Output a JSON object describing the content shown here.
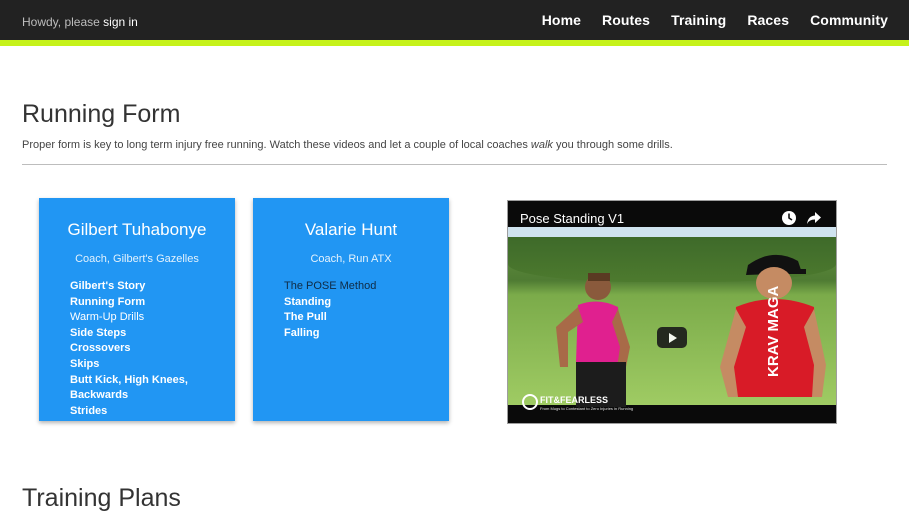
{
  "header": {
    "greeting_prefix": "Howdy, please",
    "signin_label": "sign in",
    "nav": [
      "Home",
      "Routes",
      "Training",
      "Races",
      "Community"
    ],
    "accent_color": "#c6f21a",
    "bar_color": "#222222"
  },
  "main": {
    "title": "Running Form",
    "intro_before": "Proper form is key to long term injury free running. Watch these videos and let a couple of local coaches",
    "intro_em": "walk",
    "intro_after": "you through some drills.",
    "card_color": "#2196f3",
    "coaches": [
      {
        "name": "Gilbert Tuhabonye",
        "role": "Coach, Gilbert's Gazelles",
        "links": [
          "Gilbert's Story",
          "Running Form",
          "Warm-Up Drills",
          "Side Steps",
          "Crossovers",
          "Skips",
          "Butt Kick, High Knees,",
          "Backwards",
          "Strides"
        ]
      },
      {
        "name": "Valarie Hunt",
        "role": "Coach, Run ATX",
        "links": [
          "The POSE Method",
          "Standing",
          "The Pull",
          "Falling"
        ]
      }
    ],
    "video": {
      "title": "Pose Standing V1",
      "watermark": "FIT&FEARLESS",
      "watermark_sub": "From Mugs to Contestant to Zero Injuries in Running",
      "icons": [
        "clock-icon",
        "share-icon",
        "play-icon"
      ]
    },
    "next_section_title": "Training Plans"
  }
}
